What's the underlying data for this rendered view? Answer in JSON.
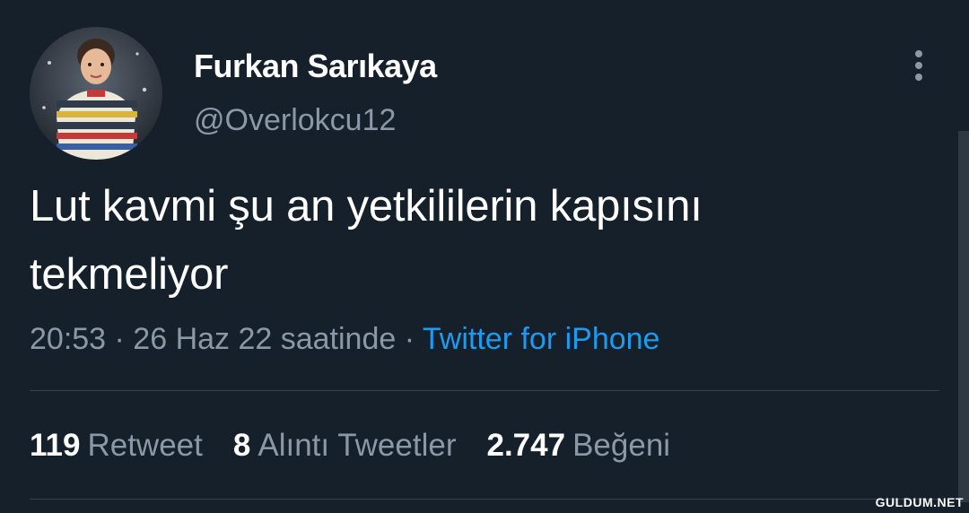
{
  "tweet": {
    "display_name": "Furkan Sarıkaya",
    "handle": "@Overlokcu12",
    "text_line1": "Lut kavmi şu an yetkililerin kapısını",
    "text_line2": "tekmeliyor",
    "timestamp": "20:53 · 26 Haz 22 saatinde",
    "separator": " · ",
    "source": "Twitter for iPhone"
  },
  "stats": [
    {
      "count": "119",
      "label": "Retweet"
    },
    {
      "count": "8",
      "label": "Alıntı Tweetler"
    },
    {
      "count": "2.747",
      "label": "Beğeni"
    }
  ],
  "watermark": "GULDUM.NET",
  "colors": {
    "background": "#15202b",
    "primary_text": "#ffffff",
    "secondary_text": "#8b98a5",
    "link": "#1d9bf0",
    "divider": "#38444d"
  },
  "icons": {
    "more": "more-vertical-icon"
  }
}
